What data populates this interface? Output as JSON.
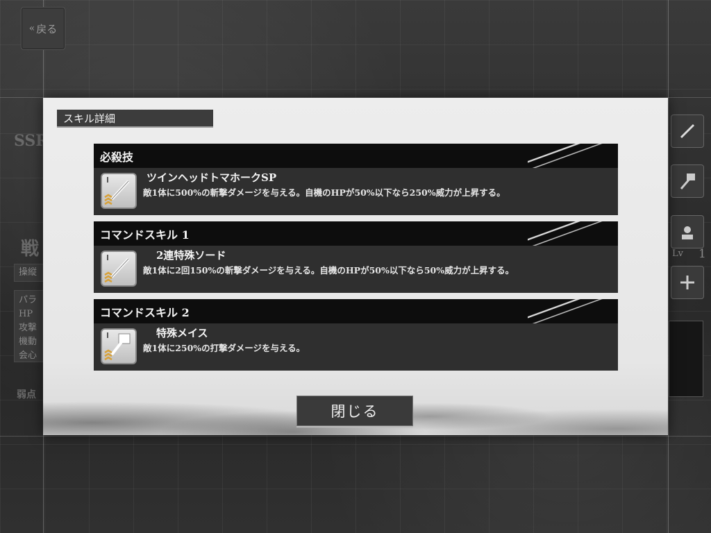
{
  "background": {
    "back_button_label": "戻る",
    "left_texts": [
      "SSR",
      "戦",
      "操縦",
      "パラ",
      "HP",
      "攻撃",
      "機動",
      "会心",
      "弱点"
    ],
    "lv_label": "Lv",
    "lv_value": "1"
  },
  "modal": {
    "title": "スキル詳細",
    "close_label": "閉じる",
    "skills": [
      {
        "category": "必殺技",
        "name": "ツインヘッドトマホークSP",
        "description": "敵1体に500%の斬撃ダメージを与える。自機のHPが50%以下なら250%威力が上昇する。",
        "icon": "sword-icon"
      },
      {
        "category": "コマンドスキル 1",
        "name": "2連特殊ソード",
        "description": "敵1体に2回150%の斬撃ダメージを与える。自機のHPが50%以下なら50%威力が上昇する。",
        "icon": "sword-icon"
      },
      {
        "category": "コマンドスキル 2",
        "name": "特殊メイス",
        "description": "敵1体に250%の打撃ダメージを与える。",
        "icon": "mace-icon"
      }
    ]
  },
  "colors": {
    "modal_bg": "#ededed",
    "header_bg": "#0d0d0d",
    "card_bg": "#2f2f2f",
    "rank_chevron": "#d8a23a"
  }
}
